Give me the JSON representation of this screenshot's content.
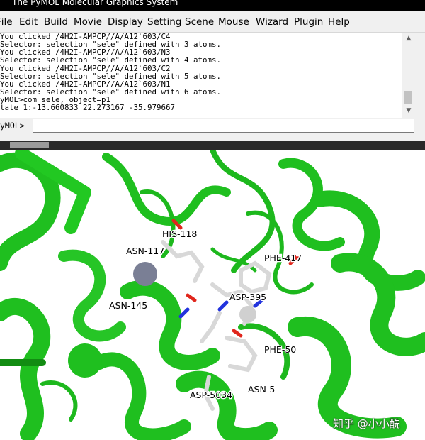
{
  "window": {
    "title": "The PyMOL Molecular Graphics System"
  },
  "menubar": {
    "items": [
      {
        "label": "File",
        "mnemonic": "F",
        "rest": "ile"
      },
      {
        "label": "Edit",
        "mnemonic": "E",
        "rest": "dit"
      },
      {
        "label": "Build",
        "mnemonic": "B",
        "rest": "uild"
      },
      {
        "label": "Movie",
        "mnemonic": "M",
        "rest": "ovie"
      },
      {
        "label": "Display",
        "mnemonic": "D",
        "rest": "isplay"
      },
      {
        "label": "Setting",
        "mnemonic": "S",
        "rest": "etting"
      },
      {
        "label": "Scene",
        "mnemonic": "S",
        "rest": "cene"
      },
      {
        "label": "Mouse",
        "mnemonic": "M",
        "rest": "ouse"
      },
      {
        "label": "Wizard",
        "mnemonic": "W",
        "rest": "izard"
      },
      {
        "label": "Plugin",
        "mnemonic": "P",
        "rest": "lugin"
      },
      {
        "label": "Help",
        "mnemonic": "H",
        "rest": "elp"
      }
    ]
  },
  "console": {
    "lines": [
      "You clicked /4H2I-AMPCP//A/A12`603/C4",
      "Selector: selection \"sele\" defined with 3 atoms.",
      "You clicked /4H2I-AMPCP//A/A12`603/N3",
      "Selector: selection \"sele\" defined with 4 atoms.",
      "You clicked /4H2I-AMPCP//A/A12`603/C2",
      "Selector: selection \"sele\" defined with 5 atoms.",
      "You clicked /4H2I-AMPCP//A/A12`603/N1",
      "Selector: selection \"sele\" defined with 6 atoms.",
      "yMOL>com sele, object=p1",
      "tate 1:-13.660833 22.273167 -35.979667"
    ]
  },
  "command": {
    "prompt": "yMOL>",
    "value": ""
  },
  "viewer": {
    "residue_labels": [
      {
        "text": "HIS-118"
      },
      {
        "text": "ASN-117"
      },
      {
        "text": "PHE-417"
      },
      {
        "text": "ASP-395"
      },
      {
        "text": "ASN-145"
      },
      {
        "text": "PHE-50"
      },
      {
        "text": "ASP-5034"
      },
      {
        "text": "ASN-5"
      }
    ],
    "colors": {
      "cartoon": "#1fbf1f",
      "cartoon_dark": "#128c12",
      "stick": "#d8d8d8",
      "metal": "#7a7f95",
      "background": "#ffffff"
    }
  },
  "watermark": {
    "text": "知乎 @小小酰"
  }
}
